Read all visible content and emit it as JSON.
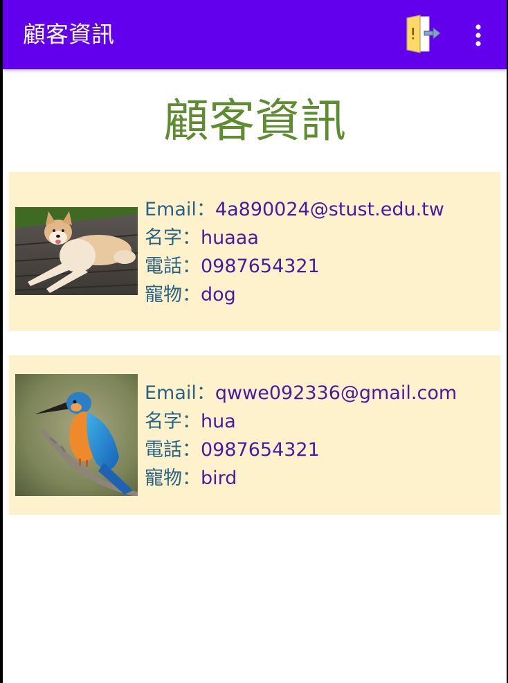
{
  "appbar": {
    "title": "顧客資訊",
    "colors": {
      "background": "#6200ee",
      "text": "#ffffff"
    },
    "actions": [
      "exit-door-icon",
      "more-vert-icon"
    ]
  },
  "page_title": "顧客資訊",
  "colors": {
    "page_title": "#5e8c31",
    "card_background": "#fef2cd",
    "field_label": "#2a6283",
    "field_value": "#4b1aa2"
  },
  "customers": [
    {
      "email_label": "Email：",
      "email": "4a890024@stust.edu.tw",
      "name_label": "名字：",
      "name": "huaaa",
      "phone_label": "電話：",
      "phone": "0987654321",
      "pet_label": "寵物：",
      "pet": "dog",
      "photo": "dog-photo"
    },
    {
      "email_label": "Email：",
      "email": "qwwe092336@gmail.com",
      "name_label": "名字：",
      "name": "hua",
      "phone_label": "電話：",
      "phone": "0987654321",
      "pet_label": "寵物：",
      "pet": "bird",
      "photo": "kingfisher-photo"
    }
  ]
}
